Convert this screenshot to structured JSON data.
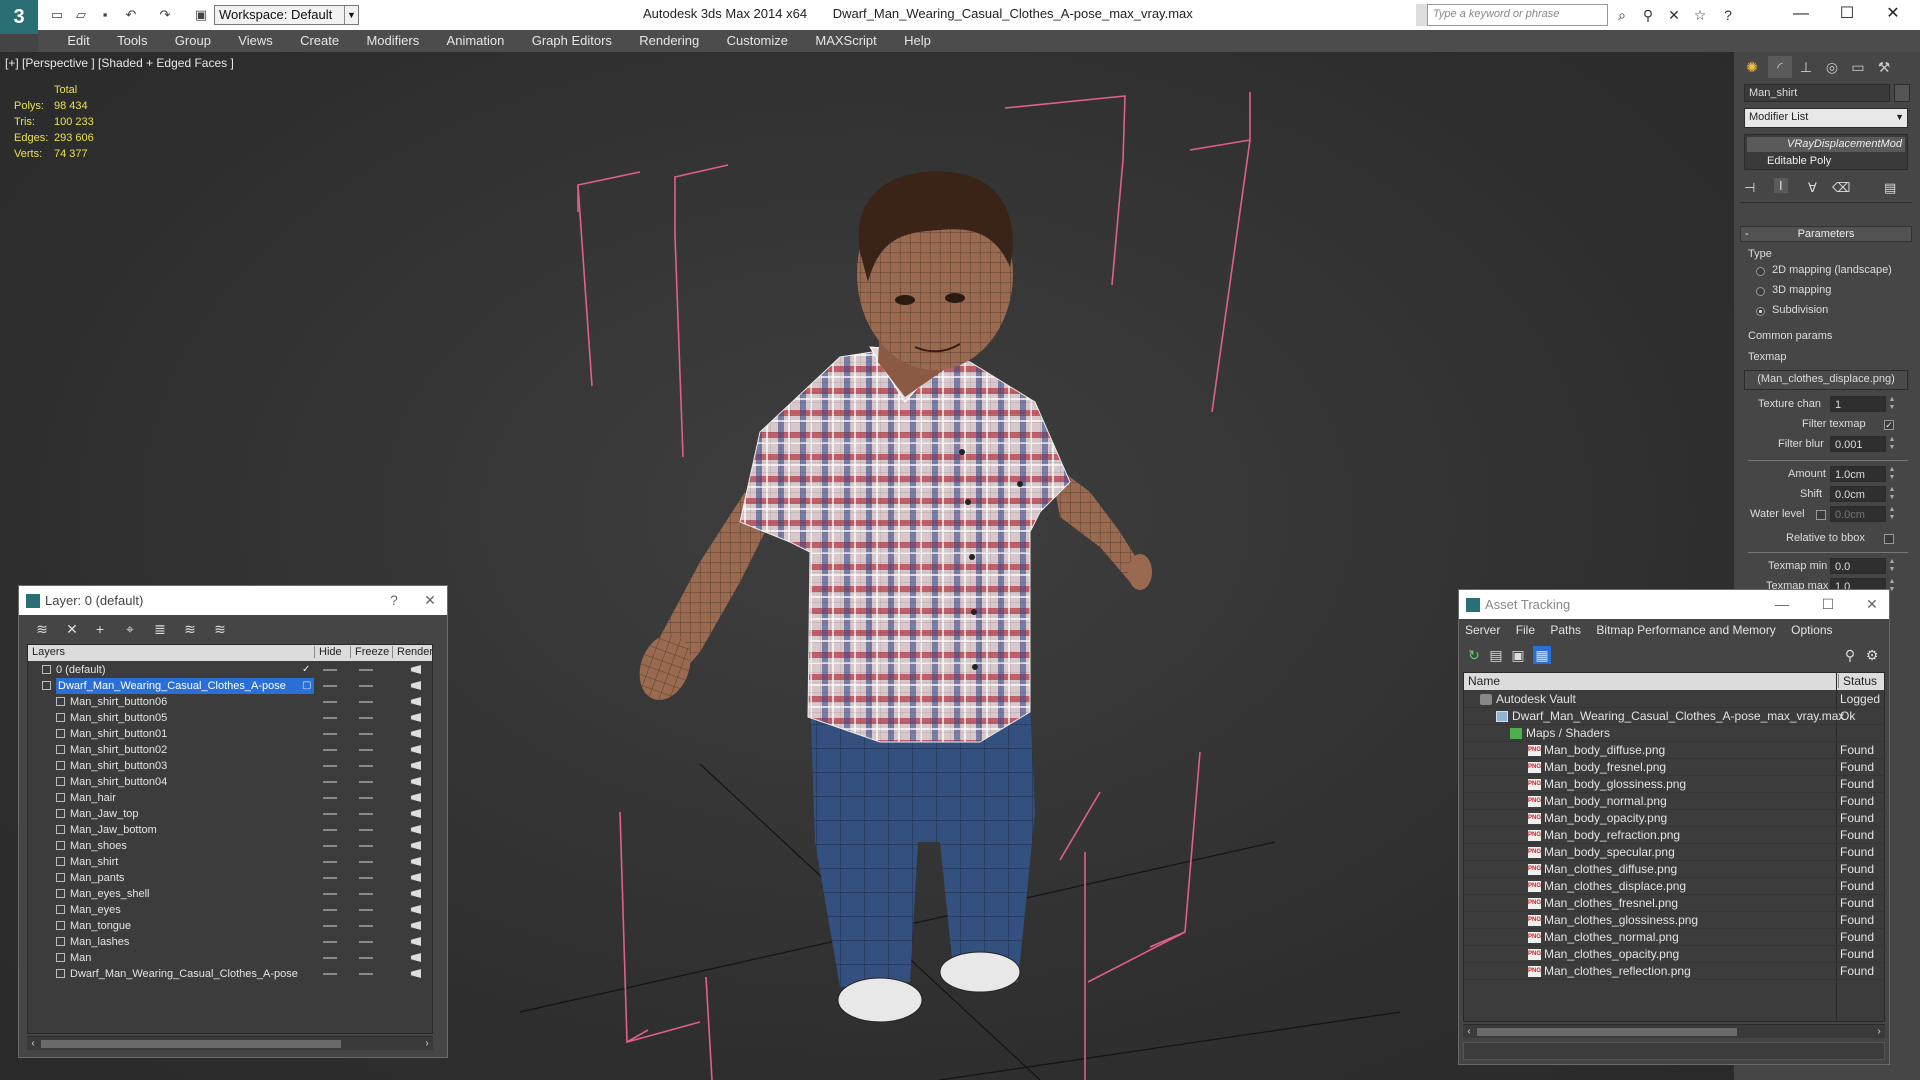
{
  "titlebar": {
    "workspace": "Workspace: Default",
    "app_name": "Autodesk 3ds Max 2014 x64",
    "file_name": "Dwarf_Man_Wearing_Casual_Clothes_A-pose_max_vray.max",
    "search_placeholder": "Type a keyword or phrase"
  },
  "menu": [
    "Edit",
    "Tools",
    "Group",
    "Views",
    "Create",
    "Modifiers",
    "Animation",
    "Graph Editors",
    "Rendering",
    "Customize",
    "MAXScript",
    "Help"
  ],
  "viewport": {
    "label": "[+] [Perspective ] [Shaded + Edged Faces ]",
    "stats_header": "Total",
    "stats": [
      {
        "label": "Polys:",
        "value": "98 434"
      },
      {
        "label": "Tris:",
        "value": "100 233"
      },
      {
        "label": "Edges:",
        "value": "293 606"
      },
      {
        "label": "Verts:",
        "value": "74 377"
      }
    ]
  },
  "command_panel": {
    "object_name": "Man_shirt",
    "modifier_list": "Modifier List",
    "stack": [
      "VRayDisplacementMod",
      "Editable Poly"
    ],
    "parameters_title": "Parameters",
    "type_label": "Type",
    "type_options": [
      "2D mapping (landscape)",
      "3D mapping",
      "Subdivision"
    ],
    "selected_type": "Subdivision",
    "common_params": "Common params",
    "texmap_label": "Texmap",
    "texmap_value": "(Man_clothes_displace.png)",
    "texture_chan_label": "Texture chan",
    "texture_chan_value": "1",
    "filter_texmap_label": "Filter texmap",
    "filter_blur_label": "Filter blur",
    "filter_blur_value": "0.001",
    "amount_label": "Amount",
    "amount_value": "1.0cm",
    "shift_label": "Shift",
    "shift_value": "0.0cm",
    "water_level_label": "Water level",
    "water_level_value": "0.0cm",
    "relative_bbox_label": "Relative to bbox",
    "texmap_min_label": "Texmap min",
    "texmap_min_value": "0.0",
    "texmap_max_label": "Texmap max",
    "texmap_max_value": "1.0"
  },
  "layer_dialog": {
    "title": "Layer: 0 (default)",
    "help": "?",
    "columns": [
      "Layers",
      "Hide",
      "Freeze",
      "Render"
    ],
    "layers": [
      {
        "name": "0 (default)",
        "level": 0
      },
      {
        "name": "Dwarf_Man_Wearing_Casual_Clothes_A-pose",
        "level": 0,
        "selected": true
      },
      {
        "name": "Man_shirt_button06",
        "level": 1
      },
      {
        "name": "Man_shirt_button05",
        "level": 1
      },
      {
        "name": "Man_shirt_button01",
        "level": 1
      },
      {
        "name": "Man_shirt_button02",
        "level": 1
      },
      {
        "name": "Man_shirt_button03",
        "level": 1
      },
      {
        "name": "Man_shirt_button04",
        "level": 1
      },
      {
        "name": "Man_hair",
        "level": 1
      },
      {
        "name": "Man_Jaw_top",
        "level": 1
      },
      {
        "name": "Man_Jaw_bottom",
        "level": 1
      },
      {
        "name": "Man_shoes",
        "level": 1
      },
      {
        "name": "Man_shirt",
        "level": 1
      },
      {
        "name": "Man_pants",
        "level": 1
      },
      {
        "name": "Man_eyes_shell",
        "level": 1
      },
      {
        "name": "Man_eyes",
        "level": 1
      },
      {
        "name": "Man_tongue",
        "level": 1
      },
      {
        "name": "Man_lashes",
        "level": 1
      },
      {
        "name": "Man",
        "level": 1
      },
      {
        "name": "Dwarf_Man_Wearing_Casual_Clothes_A-pose",
        "level": 1
      }
    ]
  },
  "asset_dialog": {
    "title": "Asset Tracking",
    "menu": [
      "Server",
      "File",
      "Paths",
      "Bitmap Performance and Memory",
      "Options"
    ],
    "columns": [
      "Name",
      "Status"
    ],
    "rows": [
      {
        "name": "Autodesk Vault",
        "status": "Logged",
        "level": 0,
        "kind": "vault"
      },
      {
        "name": "Dwarf_Man_Wearing_Casual_Clothes_A-pose_max_vray.max",
        "status": "Ok",
        "level": 1,
        "kind": "file"
      },
      {
        "name": "Maps / Shaders",
        "status": "",
        "level": 2,
        "kind": "folder"
      },
      {
        "name": "Man_body_diffuse.png",
        "status": "Found",
        "level": 3,
        "kind": "png"
      },
      {
        "name": "Man_body_fresnel.png",
        "status": "Found",
        "level": 3,
        "kind": "png"
      },
      {
        "name": "Man_body_glossiness.png",
        "status": "Found",
        "level": 3,
        "kind": "png"
      },
      {
        "name": "Man_body_normal.png",
        "status": "Found",
        "level": 3,
        "kind": "png"
      },
      {
        "name": "Man_body_opacity.png",
        "status": "Found",
        "level": 3,
        "kind": "png"
      },
      {
        "name": "Man_body_refraction.png",
        "status": "Found",
        "level": 3,
        "kind": "png"
      },
      {
        "name": "Man_body_specular.png",
        "status": "Found",
        "level": 3,
        "kind": "png"
      },
      {
        "name": "Man_clothes_diffuse.png",
        "status": "Found",
        "level": 3,
        "kind": "png"
      },
      {
        "name": "Man_clothes_displace.png",
        "status": "Found",
        "level": 3,
        "kind": "png"
      },
      {
        "name": "Man_clothes_fresnel.png",
        "status": "Found",
        "level": 3,
        "kind": "png"
      },
      {
        "name": "Man_clothes_glossiness.png",
        "status": "Found",
        "level": 3,
        "kind": "png"
      },
      {
        "name": "Man_clothes_normal.png",
        "status": "Found",
        "level": 3,
        "kind": "png"
      },
      {
        "name": "Man_clothes_opacity.png",
        "status": "Found",
        "level": 3,
        "kind": "png"
      },
      {
        "name": "Man_clothes_reflection.png",
        "status": "Found",
        "level": 3,
        "kind": "png"
      }
    ]
  },
  "colors": {
    "accent": "#2a6f73",
    "selection": "#2a6fd6",
    "stats": "#e8e050",
    "bbox": "#e0608a"
  }
}
